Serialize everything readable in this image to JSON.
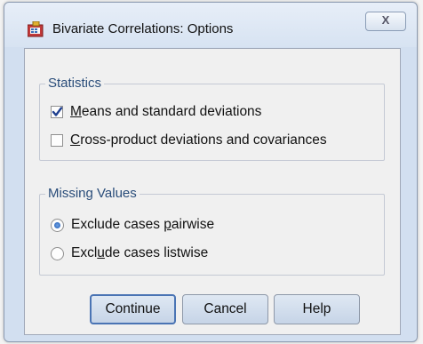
{
  "window": {
    "title": "Bivariate Correlations: Options",
    "close_label": "X"
  },
  "statistics": {
    "title": "Statistics",
    "items": [
      {
        "label_pre": "",
        "mnemonic": "M",
        "label_post": "eans and standard deviations",
        "checked": true
      },
      {
        "label_pre": "",
        "mnemonic": "C",
        "label_post": "ross-product deviations and covariances",
        "checked": false
      }
    ]
  },
  "missing": {
    "title": "Missing Values",
    "items": [
      {
        "label_pre": "Exclude cases ",
        "mnemonic": "p",
        "label_post": "airwise",
        "selected": true
      },
      {
        "label_pre": "Excl",
        "mnemonic": "u",
        "label_post": "de cases listwise",
        "selected": false
      }
    ]
  },
  "buttons": {
    "continue": "Continue",
    "cancel": "Cancel",
    "help": "Help"
  }
}
